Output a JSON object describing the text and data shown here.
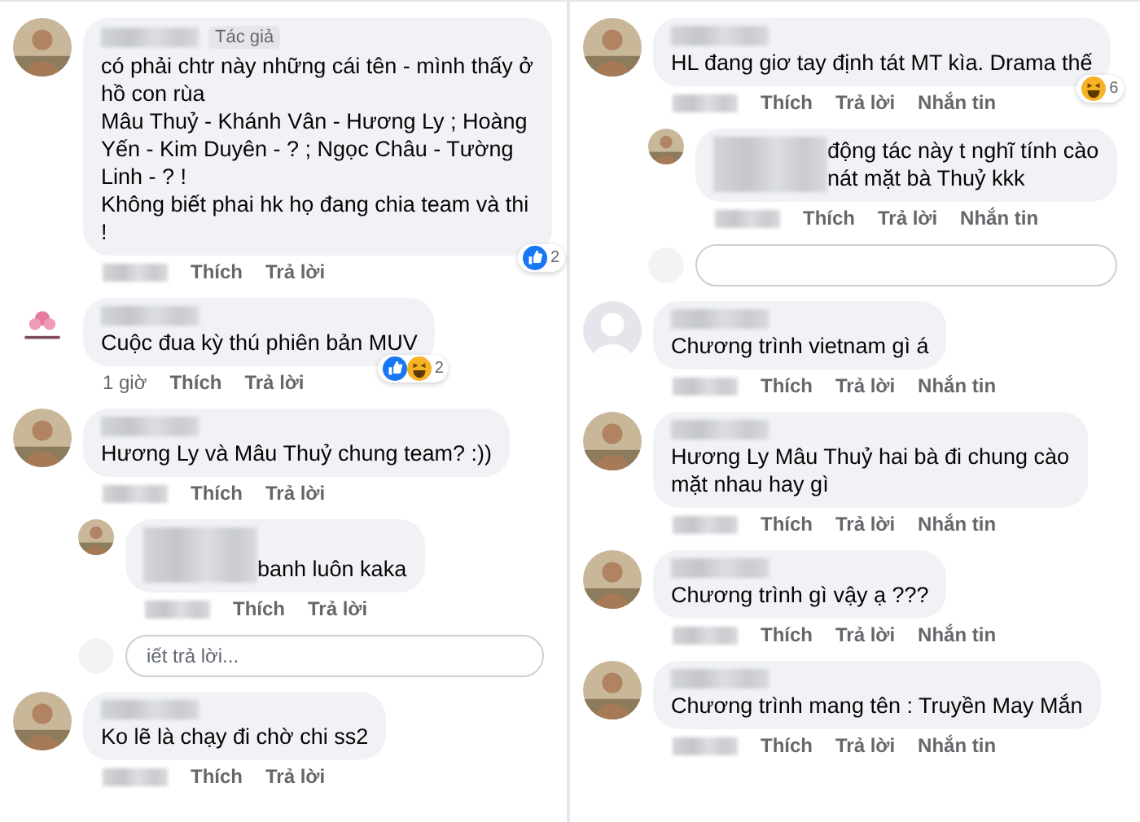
{
  "columns": [
    {
      "items": [
        {
          "kind": "comment",
          "reply": false,
          "avatar": {
            "kind": "photo"
          },
          "badge": "Tác giả",
          "text": "có phải chtr này những cái tên - mình thấy ở\nhồ con rùa\nMâu Thuỷ - Khánh Vân - Hương Ly ; Hoàng\nYến - Kim Duyên - ? ; Ngọc Châu - Tường\nLinh - ? !\nKhông biết phai hk họ đang chia team và thi\n!",
          "actions": [
            "Thích",
            "Trả lời"
          ],
          "reactions": {
            "icons": [
              {
                "kind": "like"
              }
            ],
            "count": "2"
          }
        },
        {
          "kind": "comment",
          "reply": false,
          "avatar": {
            "kind": "logo"
          },
          "text": "Cuộc đua kỳ thú phiên bản MUV",
          "time": "1 giờ",
          "actions": [
            "Thích",
            "Trả lời"
          ],
          "reactions": {
            "icons": [
              {
                "kind": "like"
              },
              {
                "kind": "haha"
              }
            ],
            "count": "2"
          }
        },
        {
          "kind": "comment",
          "reply": false,
          "avatar": {
            "kind": "photo"
          },
          "text": "Hương Ly và Mâu Thuỷ chung team? :))",
          "actions": [
            "Thích",
            "Trả lời"
          ]
        },
        {
          "kind": "comment",
          "reply": true,
          "avatar": {
            "kind": "photo"
          },
          "text": "banh luôn kaka",
          "actions": [
            "Thích",
            "Trả lời"
          ]
        },
        {
          "kind": "reply_field",
          "placeholder": "iết trả lời..."
        },
        {
          "kind": "comment",
          "reply": false,
          "avatar": {
            "kind": "photo"
          },
          "text": "Ko lẽ là chạy đi chờ chi ss2",
          "actions": [
            "Thích",
            "Trả lời"
          ]
        }
      ]
    },
    {
      "items": [
        {
          "kind": "comment",
          "reply": false,
          "avatar": {
            "kind": "photo"
          },
          "text": "HL đang giơ tay định tát MT kìa. Drama thế",
          "actions": [
            "Thích",
            "Trả lời",
            "Nhắn tin"
          ],
          "reactions": {
            "icons": [
              {
                "kind": "haha"
              }
            ],
            "count": "6"
          }
        },
        {
          "kind": "comment",
          "reply": true,
          "avatar": {
            "kind": "photo"
          },
          "text": "động tác này t nghĩ tính cào\nnát mặt bà Thuỷ kkk",
          "actions": [
            "Thích",
            "Trả lời",
            "Nhắn tin"
          ]
        },
        {
          "kind": "reply_field"
        },
        {
          "kind": "comment",
          "reply": false,
          "avatar": {
            "kind": "default"
          },
          "text": "Chương trình vietnam gì á",
          "actions": [
            "Thích",
            "Trả lời",
            "Nhắn tin"
          ]
        },
        {
          "kind": "comment",
          "reply": false,
          "avatar": {
            "kind": "photo"
          },
          "text": "Hương Ly Mâu Thuỷ hai bà đi chung cào\nmặt nhau hay gì",
          "actions": [
            "Thích",
            "Trả lời",
            "Nhắn tin"
          ]
        },
        {
          "kind": "comment",
          "reply": false,
          "avatar": {
            "kind": "photo"
          },
          "text": "Chương trình gì vậy ạ ???",
          "actions": [
            "Thích",
            "Trả lời",
            "Nhắn tin"
          ]
        },
        {
          "kind": "comment",
          "reply": false,
          "avatar": {
            "kind": "photo"
          },
          "text": "Chương trình mang tên : Truyền May Mắn",
          "actions": [
            "Thích",
            "Trả lời",
            "Nhắn tin"
          ]
        }
      ]
    }
  ]
}
